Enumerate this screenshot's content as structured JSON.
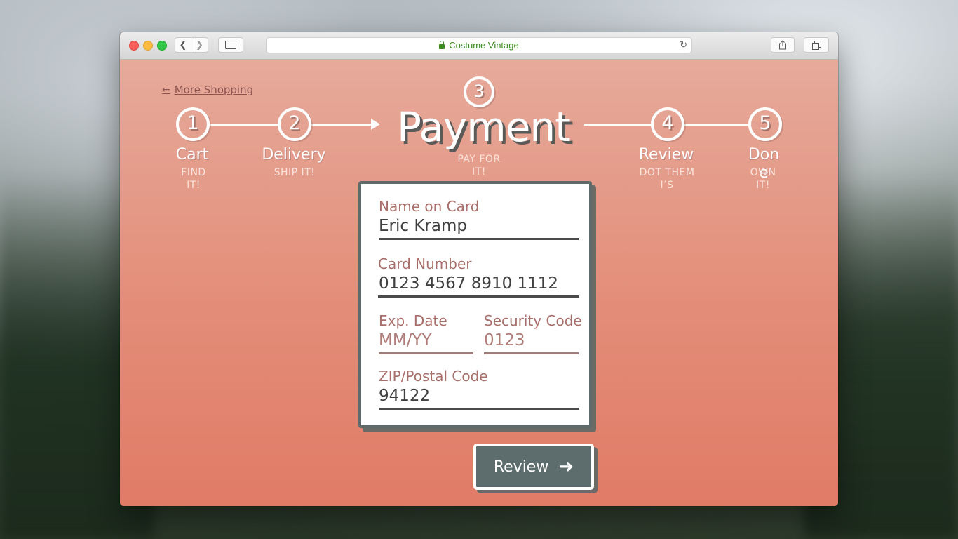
{
  "browser": {
    "site_name": "Costume Vintage",
    "icons": {
      "back": "chevron-left-icon",
      "forward": "chevron-right-icon",
      "sidebar": "sidebar-icon",
      "lock": "lock-icon",
      "reload": "reload-icon",
      "share": "share-icon",
      "tabs": "tabs-icon"
    }
  },
  "nav": {
    "back_link": "More Shopping"
  },
  "steps": [
    {
      "number": "1",
      "label": "Cart",
      "sub": "FIND IT!"
    },
    {
      "number": "2",
      "label": "Delivery",
      "sub": "SHIP IT!"
    },
    {
      "number": "3",
      "label": "Payment",
      "sub": "PAY FOR IT!"
    },
    {
      "number": "4",
      "label": "Review",
      "sub": "DOT THEM I’S"
    },
    {
      "number": "5",
      "label": "Done",
      "sub": "OWN IT!"
    }
  ],
  "form": {
    "name_on_card": {
      "label": "Name on Card",
      "value": "Eric Kramp"
    },
    "card_number": {
      "label": "Card Number",
      "value": "0123 4567 8910 1112"
    },
    "exp_date": {
      "label": "Exp. Date",
      "placeholder": "MM/YY"
    },
    "security_code": {
      "label": "Security Code",
      "placeholder": "0123"
    },
    "zip": {
      "label": "ZIP/Postal Code",
      "value": "94122"
    }
  },
  "actions": {
    "review_label": "Review"
  },
  "colors": {
    "accent": "#e38d78",
    "button": "#5d6d6d",
    "label": "#a86e6a"
  }
}
